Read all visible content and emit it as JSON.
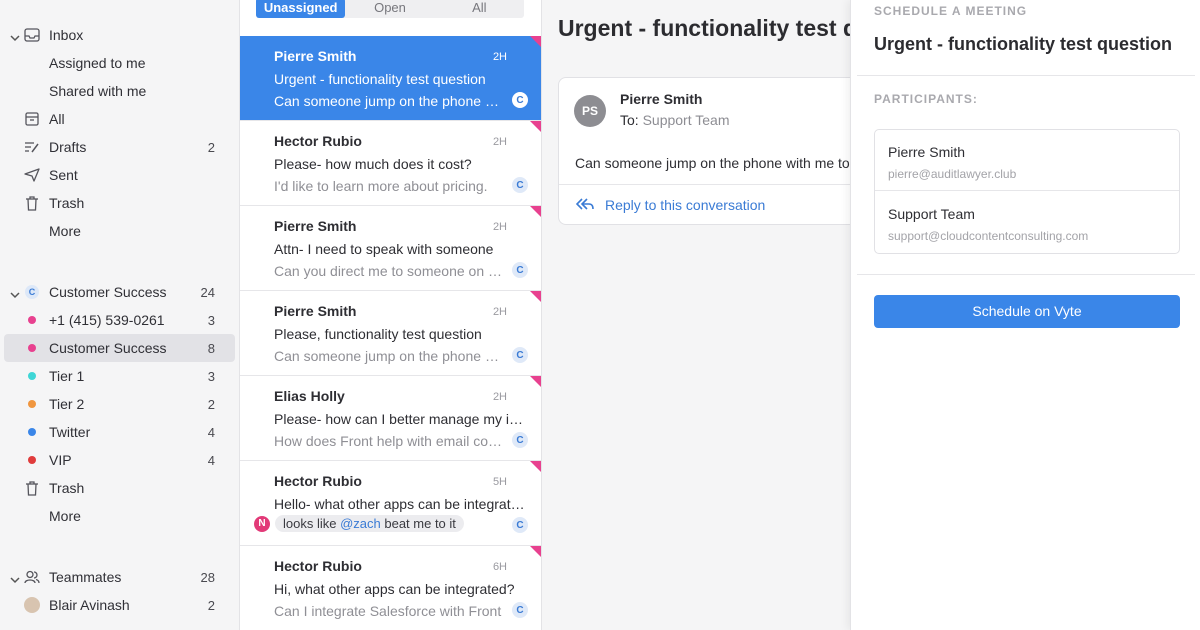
{
  "sidebar": {
    "inbox_group": {
      "header": "Inbox",
      "items": [
        {
          "label": "Assigned to me"
        },
        {
          "label": "Shared with me"
        },
        {
          "label": "All"
        },
        {
          "label": "Drafts",
          "count": "2"
        },
        {
          "label": "Sent"
        },
        {
          "label": "Trash"
        },
        {
          "label": "More"
        }
      ]
    },
    "team_group": {
      "badge": "C",
      "header": "Customer Success",
      "count": "24",
      "items": [
        {
          "label": "+1 (415) 539-0261",
          "count": "3",
          "color": "#e8418f"
        },
        {
          "label": "Customer Success",
          "count": "8",
          "color": "#e8418f",
          "selected": true
        },
        {
          "label": "Tier 1",
          "count": "3",
          "color": "#3fd6d6"
        },
        {
          "label": "Tier 2",
          "count": "2",
          "color": "#f0963f"
        },
        {
          "label": "Twitter",
          "count": "4",
          "color": "#3a86e8"
        },
        {
          "label": "VIP",
          "count": "4",
          "color": "#e03c3c"
        },
        {
          "label": "Trash"
        },
        {
          "label": "More"
        }
      ]
    },
    "teammates_group": {
      "header": "Teammates",
      "count": "28",
      "items": [
        {
          "label": "Blair Avinash",
          "count": "2"
        }
      ]
    }
  },
  "list": {
    "tabs": [
      "Unassigned",
      "Open",
      "All"
    ],
    "active_tab": "Unassigned",
    "conversations": [
      {
        "name": "Pierre Smith",
        "time": "2H",
        "subject": "Urgent - functionality test question",
        "preview": "Can someone jump on the phone with me to talk about the functionality test",
        "badge": "C",
        "selected": true
      },
      {
        "name": "Hector Rubio",
        "time": "2H",
        "subject": "Please- how much does it cost?",
        "preview": "I'd like to learn more about pricing.",
        "badge": "C"
      },
      {
        "name": "Pierre Smith",
        "time": "2H",
        "subject": "Attn- I need to speak with someone",
        "preview": "Can you direct me to someone on your team",
        "badge": "C"
      },
      {
        "name": "Pierre Smith",
        "time": "2H",
        "subject": "Please, functionality test question",
        "preview": "Can someone jump on the phone with me",
        "badge": "C"
      },
      {
        "name": "Elias Holly",
        "time": "2H",
        "subject": "Please- how can I better manage my inbox",
        "preview": "How does Front help with email collaboration",
        "badge": "C"
      },
      {
        "name": "Hector Rubio",
        "time": "5H",
        "subject": "Hello- what other apps can be integrated?",
        "comment": {
          "avatar": "N",
          "text_before": "looks like ",
          "mention": "@zach",
          "text_after": " beat me to it"
        },
        "badge": "C"
      },
      {
        "name": "Hector Rubio",
        "time": "6H",
        "subject": "Hi, what other apps can be integrated?",
        "preview": "Can I integrate Salesforce with Front",
        "badge": "C"
      }
    ]
  },
  "conversation": {
    "title": "Urgent - functionality test question",
    "message": {
      "avatar": "PS",
      "from": "Pierre Smith",
      "to_label": "To:",
      "to_value": "Support Team",
      "body": "Can someone jump on the phone with me to talk"
    },
    "reply_label": "Reply to this conversation"
  },
  "panel": {
    "heading": "SCHEDULE A MEETING",
    "title": "Urgent - functionality test question",
    "participants_label": "PARTICIPANTS:",
    "participants": [
      {
        "name": "Pierre Smith",
        "email": "pierre@auditlawyer.club"
      },
      {
        "name": "Support Team",
        "email": "support@cloudcontentconsulting.com"
      }
    ],
    "button_label": "Schedule on Vyte"
  }
}
